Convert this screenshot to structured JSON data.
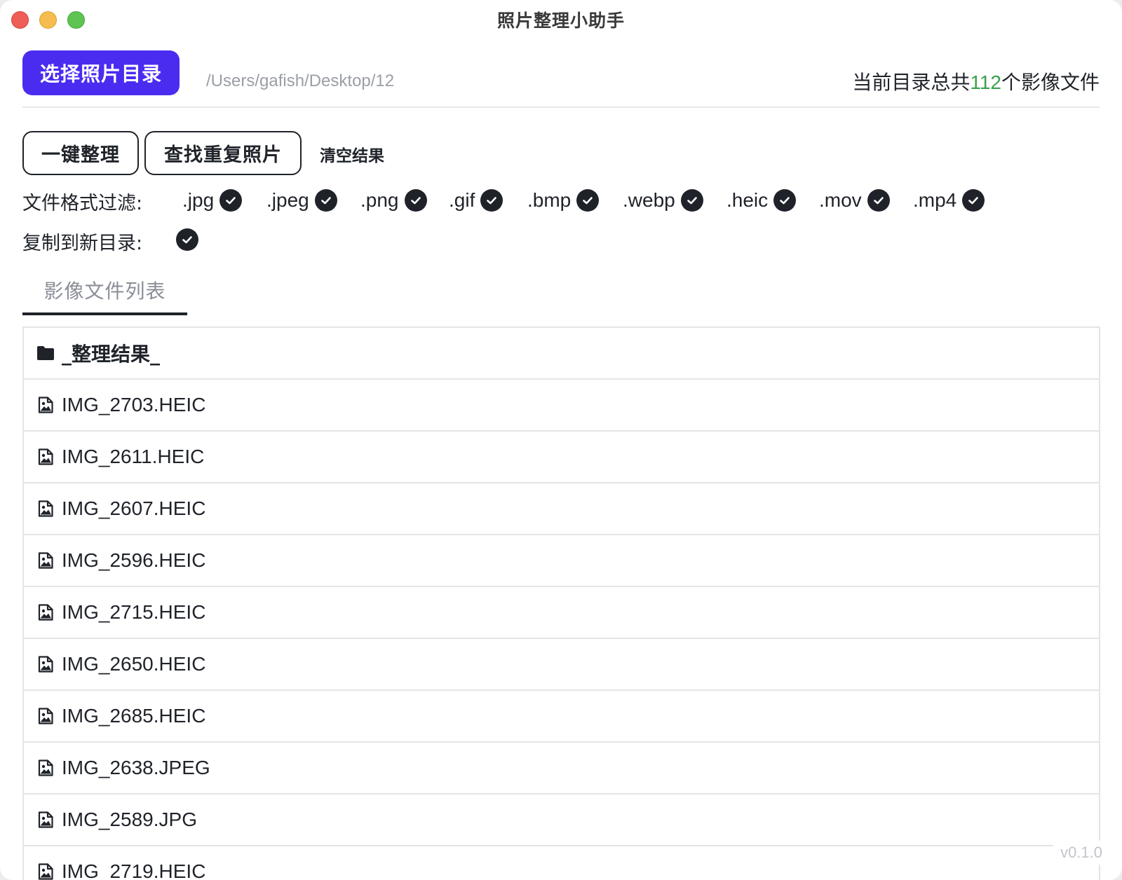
{
  "window": {
    "title": "照片整理小助手"
  },
  "header": {
    "select_dir_label": "选择照片目录",
    "dir_path": "/Users/gafish/Desktop/12",
    "count_prefix": "当前目录总共",
    "count_value": "112",
    "count_suffix": "个影像文件"
  },
  "actions": {
    "organize_label": "一键整理",
    "find_dupes_label": "查找重复照片",
    "clear_label": "清空结果"
  },
  "filters": {
    "label": "文件格式过滤:",
    "formats": [
      {
        "ext": ".jpg",
        "checked": true
      },
      {
        "ext": ".jpeg",
        "checked": true
      },
      {
        "ext": ".png",
        "checked": true
      },
      {
        "ext": ".gif",
        "checked": true
      },
      {
        "ext": ".bmp",
        "checked": true
      },
      {
        "ext": ".webp",
        "checked": true
      },
      {
        "ext": ".heic",
        "checked": true
      },
      {
        "ext": ".mov",
        "checked": true
      },
      {
        "ext": ".mp4",
        "checked": true
      }
    ]
  },
  "copy_option": {
    "label": "复制到新目录:",
    "checked": true
  },
  "tabs": [
    {
      "label": "影像文件列表",
      "active": true
    }
  ],
  "file_list": [
    {
      "name": "_整理结果_",
      "type": "folder",
      "icon": "folder-icon"
    },
    {
      "name": "IMG_2703.HEIC",
      "type": "image",
      "icon": "image-file-icon"
    },
    {
      "name": "IMG_2611.HEIC",
      "type": "image",
      "icon": "image-file-icon"
    },
    {
      "name": "IMG_2607.HEIC",
      "type": "image",
      "icon": "image-file-icon"
    },
    {
      "name": "IMG_2596.HEIC",
      "type": "image",
      "icon": "image-file-icon"
    },
    {
      "name": "IMG_2715.HEIC",
      "type": "image",
      "icon": "image-file-icon"
    },
    {
      "name": "IMG_2650.HEIC",
      "type": "image",
      "icon": "image-file-icon"
    },
    {
      "name": "IMG_2685.HEIC",
      "type": "image",
      "icon": "image-file-icon"
    },
    {
      "name": "IMG_2638.JPEG",
      "type": "image",
      "icon": "image-file-icon"
    },
    {
      "name": "IMG_2589.JPG",
      "type": "image",
      "icon": "image-file-icon"
    },
    {
      "name": "IMG_2719.HEIC",
      "type": "image",
      "icon": "image-file-icon"
    }
  ],
  "version": "v0.1.0",
  "colors": {
    "primary": "#4a2cf0",
    "count_highlight": "#3aa14a",
    "text": "#1f2329"
  }
}
